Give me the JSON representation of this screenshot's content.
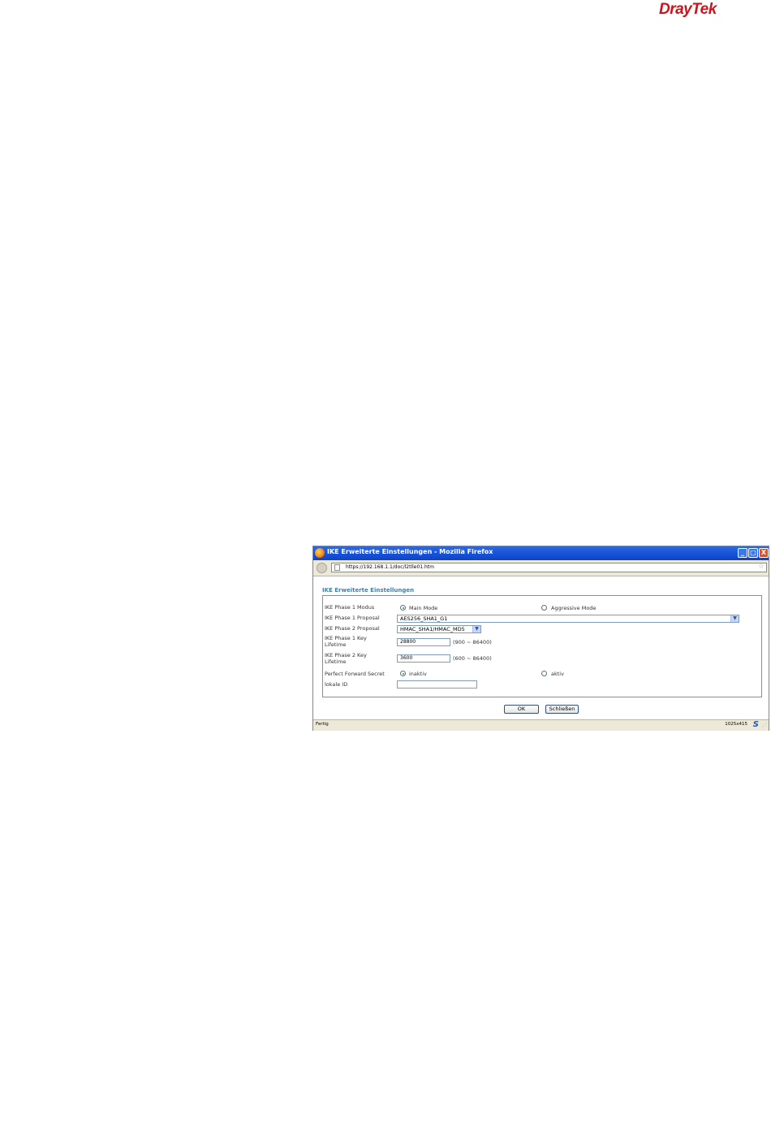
{
  "logo": {
    "part1": "Dray",
    "part2": "Tek"
  },
  "window": {
    "title": "IKE Erweiterte Einstellungen - Mozilla Firefox",
    "url": "https://192.168.1.1/doc/l2tlle01.htm",
    "minimize_glyph": "_",
    "maximize_glyph": "□",
    "close_glyph": "X",
    "status": "Fertig",
    "dimensions": "1025x415",
    "status_icon": "S"
  },
  "form": {
    "heading": "IKE Erweiterte Einstellungen",
    "phase1_mode": {
      "label": "IKE Phase 1 Modus",
      "options": [
        "Main Mode",
        "Aggressive Mode"
      ],
      "selected": "Main Mode"
    },
    "phase1_proposal": {
      "label": "IKE Phase 1 Proposal",
      "value": "AES256_SHA1_G1"
    },
    "phase2_proposal": {
      "label": "IKE Phase 2 Proposal",
      "value": "HMAC_SHA1/HMAC_MD5"
    },
    "phase1_lifetime": {
      "label": "IKE Phase 1 Key Lifetime",
      "value": "28800",
      "range": "(900 ~ 86400)"
    },
    "phase2_lifetime": {
      "label": "IKE Phase 2 Key Lifetime",
      "value": "3600",
      "range": "(600 ~ 86400)"
    },
    "pfs": {
      "label": "Perfect Forward Secret",
      "options": [
        "inaktiv",
        "aktiv"
      ],
      "selected": "inaktiv"
    },
    "local_id": {
      "label": "lokale ID",
      "value": ""
    },
    "ok_label": "OK",
    "close_label": "Schließen"
  },
  "icons": {
    "firefox": "firefox-icon",
    "back": "back-icon",
    "page": "page-icon",
    "bookmark": "star-icon",
    "dropdown": "chevron-down-icon"
  }
}
